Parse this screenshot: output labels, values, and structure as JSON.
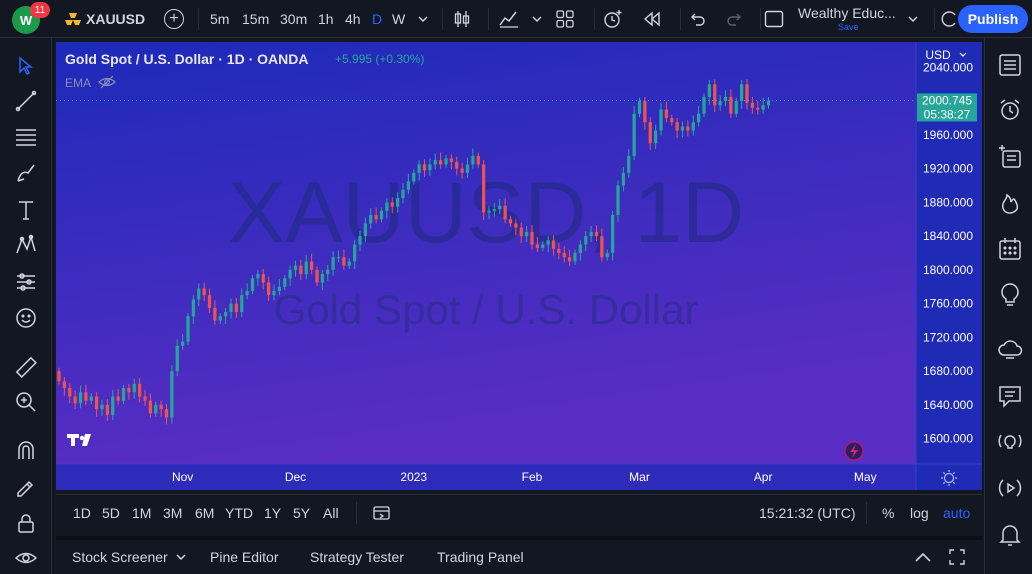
{
  "topbar": {
    "avatar_text": "W",
    "notification_count": "11",
    "symbol": "XAUUSD",
    "intervals": [
      "5m",
      "15m",
      "30m",
      "1h",
      "4h",
      "D",
      "W"
    ],
    "active_interval": "D",
    "layout_name": "Wealthy Educ...",
    "layout_save": "Save",
    "publish_label": "Publish"
  },
  "legend": {
    "title": "Gold Spot / U.S. Dollar · 1D · OANDA",
    "change": "+5.995 (+0.30%)",
    "indicator": "EMA"
  },
  "chart": {
    "currency": "USD",
    "watermark_symbol": "XAUUSD, 1D",
    "watermark_name": "Gold Spot / U.S. Dollar",
    "price_labels": [
      "2040.000",
      "2000.000",
      "1960.000",
      "1920.000",
      "1880.000",
      "1840.000",
      "1800.000",
      "1760.000",
      "1720.000",
      "1680.000",
      "1640.000",
      "1600.000"
    ],
    "time_labels": [
      "Nov",
      "Dec",
      "2023",
      "Feb",
      "Mar",
      "Apr",
      "May"
    ],
    "last_price": "2000.745",
    "countdown": "05:38:27",
    "colors": {
      "bg_top": "#1e2bb8",
      "bg_bottom": "#5a2bc2",
      "up": "#26a69a",
      "down": "#ef5350",
      "price_tag": "#26a69a"
    }
  },
  "rangebar": {
    "ranges": [
      "1D",
      "5D",
      "1M",
      "3M",
      "6M",
      "YTD",
      "1Y",
      "5Y",
      "All"
    ],
    "clock": "15:21:32 (UTC)",
    "percent": "%",
    "log": "log",
    "auto": "auto"
  },
  "panelbar": {
    "tabs": [
      "Stock Screener",
      "Pine Editor",
      "Strategy Tester",
      "Trading Panel"
    ]
  },
  "chart_data": {
    "type": "candlestick",
    "title": "Gold Spot / U.S. Dollar · 1D · OANDA",
    "xlabel": "",
    "ylabel": "",
    "ylim": [
      1570,
      2070
    ],
    "months": [
      {
        "label": "Nov",
        "index": 23
      },
      {
        "label": "Dec",
        "index": 44
      },
      {
        "label": "2023",
        "index": 66
      },
      {
        "label": "Feb",
        "index": 88
      },
      {
        "label": "Mar",
        "index": 108
      },
      {
        "label": "Apr",
        "index": 131
      },
      {
        "label": "May",
        "index": 150
      }
    ],
    "total_slots": 160,
    "closes": [
      1668,
      1660,
      1650,
      1642,
      1655,
      1645,
      1650,
      1635,
      1640,
      1628,
      1650,
      1645,
      1660,
      1655,
      1665,
      1650,
      1645,
      1630,
      1640,
      1635,
      1625,
      1680,
      1710,
      1715,
      1745,
      1765,
      1778,
      1770,
      1755,
      1740,
      1745,
      1750,
      1760,
      1750,
      1770,
      1775,
      1790,
      1795,
      1785,
      1770,
      1775,
      1780,
      1790,
      1800,
      1805,
      1795,
      1810,
      1800,
      1785,
      1795,
      1800,
      1815,
      1815,
      1805,
      1810,
      1830,
      1840,
      1855,
      1865,
      1860,
      1870,
      1880,
      1875,
      1885,
      1895,
      1905,
      1915,
      1925,
      1918,
      1925,
      1930,
      1925,
      1932,
      1928,
      1920,
      1915,
      1925,
      1935,
      1925,
      1868,
      1870,
      1872,
      1876,
      1860,
      1855,
      1850,
      1840,
      1845,
      1830,
      1826,
      1830,
      1835,
      1825,
      1820,
      1815,
      1810,
      1820,
      1830,
      1840,
      1845,
      1840,
      1815,
      1820,
      1865,
      1900,
      1915,
      1935,
      1985,
      2000,
      1975,
      1950,
      1965,
      1990,
      1980,
      1975,
      1965,
      1970,
      1965,
      1975,
      1985,
      2005,
      2020,
      1995,
      2000,
      2005,
      1985,
      2000,
      2020,
      1998,
      1992,
      1990,
      1995,
      2000.745
    ],
    "opens": [
      1680,
      1668,
      1660,
      1650,
      1642,
      1655,
      1645,
      1650,
      1635,
      1640,
      1628,
      1650,
      1645,
      1660,
      1655,
      1665,
      1650,
      1645,
      1630,
      1640,
      1635,
      1625,
      1680,
      1710,
      1715,
      1745,
      1765,
      1778,
      1770,
      1755,
      1740,
      1745,
      1750,
      1760,
      1750,
      1770,
      1775,
      1790,
      1795,
      1785,
      1770,
      1775,
      1780,
      1790,
      1800,
      1805,
      1795,
      1810,
      1800,
      1785,
      1795,
      1800,
      1815,
      1815,
      1805,
      1810,
      1830,
      1840,
      1855,
      1865,
      1860,
      1870,
      1880,
      1875,
      1885,
      1895,
      1905,
      1915,
      1925,
      1918,
      1925,
      1930,
      1925,
      1932,
      1928,
      1920,
      1915,
      1925,
      1935,
      1925,
      1868,
      1870,
      1872,
      1876,
      1860,
      1855,
      1850,
      1840,
      1845,
      1830,
      1826,
      1830,
      1835,
      1825,
      1820,
      1815,
      1810,
      1820,
      1830,
      1840,
      1845,
      1840,
      1815,
      1820,
      1865,
      1900,
      1915,
      1935,
      1985,
      2000,
      1975,
      1950,
      1965,
      1990,
      1980,
      1975,
      1965,
      1970,
      1965,
      1975,
      1985,
      2005,
      2020,
      1995,
      2000,
      2005,
      1985,
      2000,
      2020,
      1998,
      1992,
      1990,
      1995
    ]
  }
}
